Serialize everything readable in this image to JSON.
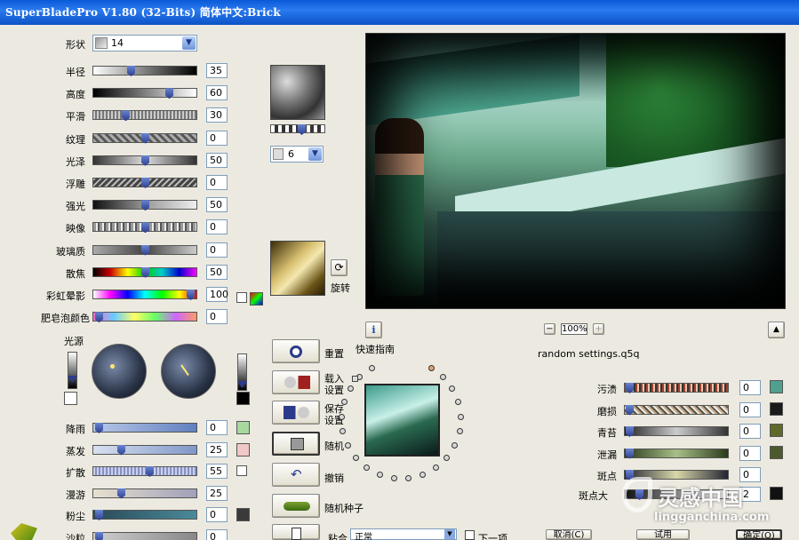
{
  "window": {
    "title": "SuperBladePro V1.80 (32-Bits)  简体中文:Brick"
  },
  "shape": {
    "label": "形状",
    "value": "14"
  },
  "params": [
    {
      "label": "半径",
      "value": "35",
      "pos": 0.35
    },
    {
      "label": "高度",
      "value": "60",
      "pos": 0.75
    },
    {
      "label": "平滑",
      "value": "30",
      "pos": 0.3
    },
    {
      "label": "纹理",
      "value": "0",
      "pos": 0.5
    },
    {
      "label": "光泽",
      "value": "50",
      "pos": 0.5
    },
    {
      "label": "浮雕",
      "value": "0",
      "pos": 0.5
    },
    {
      "label": "强光",
      "value": "50",
      "pos": 0.5
    },
    {
      "label": "映像",
      "value": "0",
      "pos": 0.5
    },
    {
      "label": "玻璃质",
      "value": "0",
      "pos": 0.5
    },
    {
      "label": "散焦",
      "value": "50",
      "pos": 0.5
    },
    {
      "label": "彩虹晕影",
      "value": "100",
      "pos": 0.97
    },
    {
      "label": "肥皂泡颜色",
      "value": "0",
      "pos": 0.02
    }
  ],
  "light": {
    "label": "光源"
  },
  "lower_params": [
    {
      "label": "降雨",
      "value": "0",
      "pos": 0.02
    },
    {
      "label": "蒸发",
      "value": "25",
      "pos": 0.25
    },
    {
      "label": "扩散",
      "value": "55",
      "pos": 0.55
    },
    {
      "label": "漫游",
      "value": "25",
      "pos": 0.25
    },
    {
      "label": "粉尘",
      "value": "0",
      "pos": 0.02
    },
    {
      "label": "沙粒",
      "value": "0",
      "pos": 0.02
    }
  ],
  "texture": {
    "value": "6"
  },
  "rotate": {
    "label": "旋转"
  },
  "quickguide": {
    "label": "快速指南"
  },
  "zoom": {
    "minus": "−",
    "value": "100%",
    "plus": "+"
  },
  "settings_file": "random settings.q5q",
  "actions": {
    "reset": "重置",
    "load1": "载入",
    "load2": "设置",
    "save1": "保存",
    "save2": "设置",
    "random": "随机",
    "undo": "撤销",
    "seed": "随机种子",
    "blend_label": "粘合",
    "blend_value": "正常",
    "next": "下一项"
  },
  "right_params": [
    {
      "label": "污渍",
      "value": "0",
      "color": "#4fa08f"
    },
    {
      "label": "磨损",
      "value": "0",
      "color": "#1a1a1a"
    },
    {
      "label": "青苔",
      "value": "0",
      "color": "#5f6a2a"
    },
    {
      "label": "泄漏",
      "value": "0",
      "color": "#4c5a2c"
    },
    {
      "label": "斑点",
      "value": "0",
      "color": ""
    }
  ],
  "spots": {
    "label": "斑点大",
    "value": "2"
  },
  "buttons": {
    "cancel": "取消(C)",
    "apply": "试用",
    "ok": "确定(O)"
  },
  "watermark": {
    "brand": "灵感中国",
    "url": "lingganchina.com"
  },
  "colors": {
    "title": "#0b52c6",
    "panel": "#eceae0",
    "thumb": "#2c3c8e"
  }
}
